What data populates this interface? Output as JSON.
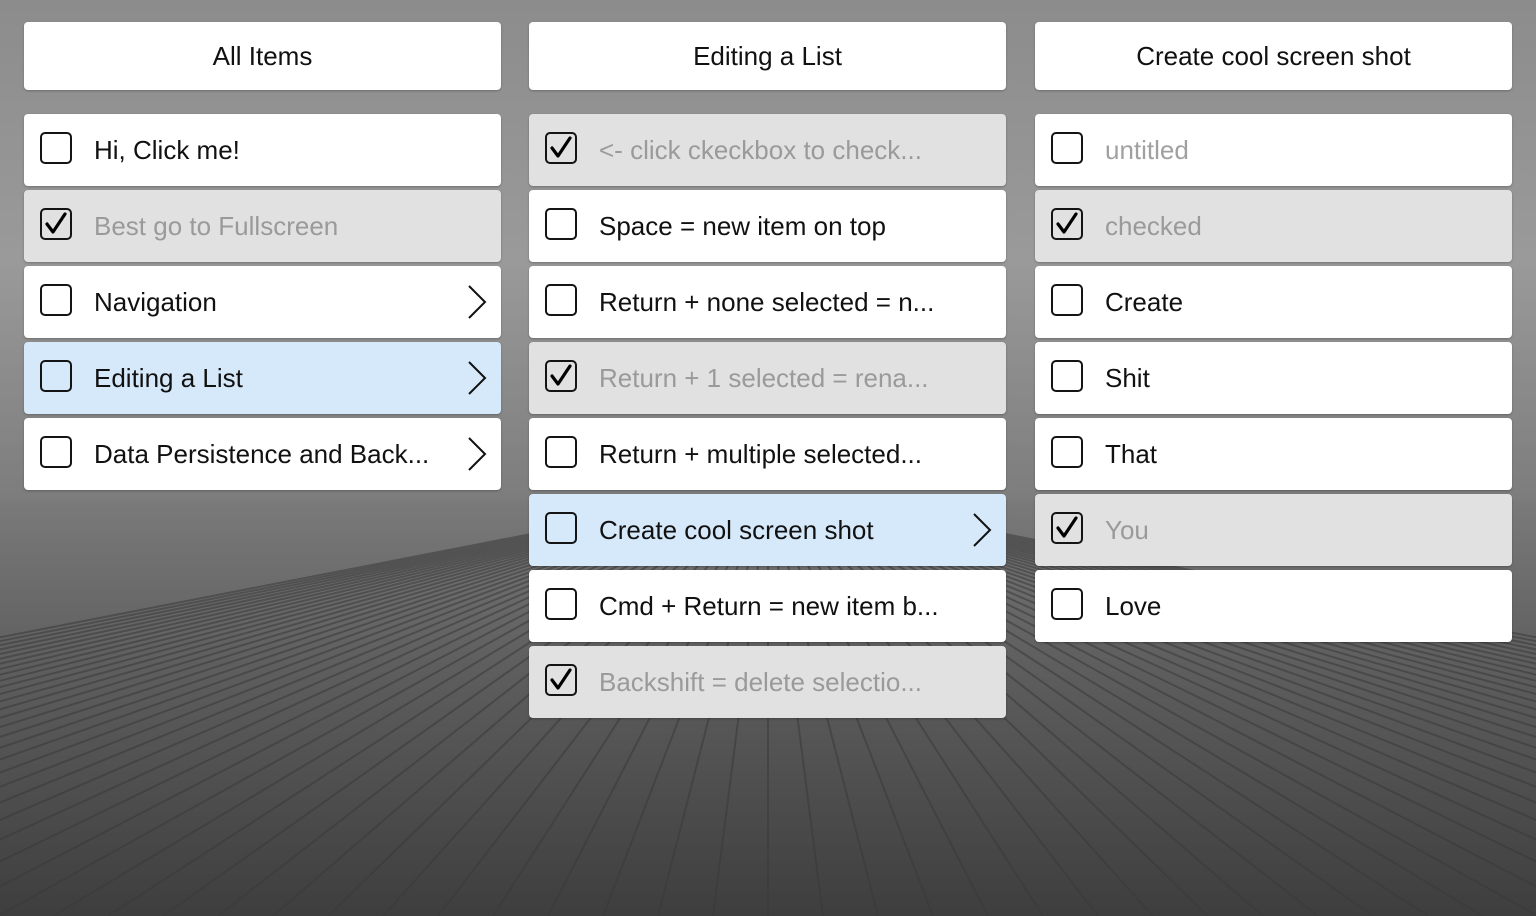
{
  "columns": [
    {
      "title": "All Items",
      "items": [
        {
          "label": "Hi, Click me!",
          "checked": false,
          "selected": false,
          "has_children": false,
          "placeholder": false
        },
        {
          "label": "Best go to Fullscreen",
          "checked": true,
          "selected": false,
          "has_children": false,
          "placeholder": false
        },
        {
          "label": "Navigation",
          "checked": false,
          "selected": false,
          "has_children": true,
          "placeholder": false
        },
        {
          "label": "Editing a List",
          "checked": false,
          "selected": true,
          "has_children": true,
          "placeholder": false
        },
        {
          "label": "Data Persistence and Back...",
          "checked": false,
          "selected": false,
          "has_children": true,
          "placeholder": false
        }
      ]
    },
    {
      "title": "Editing a List",
      "items": [
        {
          "label": "<- click ckeckbox to check...",
          "checked": true,
          "selected": false,
          "has_children": false,
          "placeholder": false
        },
        {
          "label": "Space = new item on top",
          "checked": false,
          "selected": false,
          "has_children": false,
          "placeholder": false
        },
        {
          "label": "Return + none selected = n...",
          "checked": false,
          "selected": false,
          "has_children": false,
          "placeholder": false
        },
        {
          "label": "Return + 1 selected = rena...",
          "checked": true,
          "selected": false,
          "has_children": false,
          "placeholder": false
        },
        {
          "label": "Return + multiple selected...",
          "checked": false,
          "selected": false,
          "has_children": false,
          "placeholder": false
        },
        {
          "label": "Create cool screen shot",
          "checked": false,
          "selected": true,
          "has_children": true,
          "placeholder": false
        },
        {
          "label": "Cmd + Return = new item b...",
          "checked": false,
          "selected": false,
          "has_children": false,
          "placeholder": false
        },
        {
          "label": "Backshift = delete selectio...",
          "checked": true,
          "selected": false,
          "has_children": false,
          "placeholder": false
        }
      ]
    },
    {
      "title": "Create cool screen shot",
      "items": [
        {
          "label": "untitled",
          "checked": false,
          "selected": false,
          "has_children": false,
          "placeholder": true
        },
        {
          "label": "checked",
          "checked": true,
          "selected": false,
          "has_children": false,
          "placeholder": false
        },
        {
          "label": "Create",
          "checked": false,
          "selected": false,
          "has_children": false,
          "placeholder": false
        },
        {
          "label": "Shit",
          "checked": false,
          "selected": false,
          "has_children": false,
          "placeholder": false
        },
        {
          "label": "That",
          "checked": false,
          "selected": false,
          "has_children": false,
          "placeholder": false
        },
        {
          "label": "You",
          "checked": true,
          "selected": false,
          "has_children": false,
          "placeholder": false
        },
        {
          "label": "Love",
          "checked": false,
          "selected": false,
          "has_children": false,
          "placeholder": false
        }
      ]
    }
  ],
  "colors": {
    "row_background": "#ffffff",
    "checked_row_background": "#e1e1e1",
    "selected_row_background": "#d6e9fb",
    "checked_text": "#9a9a9a",
    "text": "#111111"
  },
  "icons": {
    "checkbox": "checkbox-icon",
    "checkmark": "checkmark-icon",
    "chevron": "chevron-right-icon"
  }
}
